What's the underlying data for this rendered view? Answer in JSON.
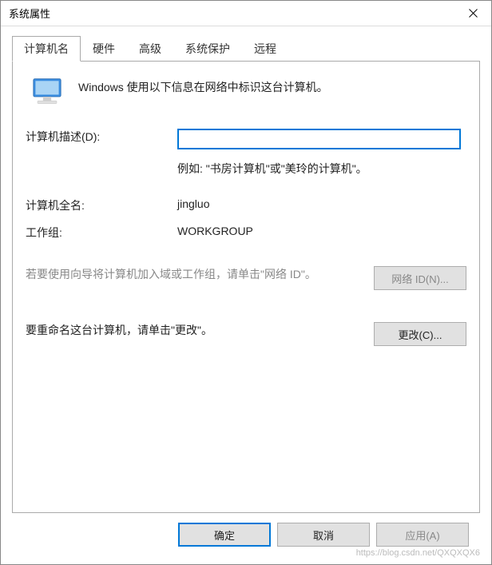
{
  "window": {
    "title": "系统属性"
  },
  "tabs": {
    "computer_name": "计算机名",
    "hardware": "硬件",
    "advanced": "高级",
    "system_protection": "系统保护",
    "remote": "远程"
  },
  "panel": {
    "intro": "Windows 使用以下信息在网络中标识这台计算机。",
    "description_label": "计算机描述(D):",
    "description_value": "",
    "description_hint": "例如: \"书房计算机\"或\"美玲的计算机\"。",
    "full_name_label": "计算机全名:",
    "full_name_value": "jingluo",
    "workgroup_label": "工作组:",
    "workgroup_value": "WORKGROUP",
    "network_id_text": "若要使用向导将计算机加入域或工作组，请单击\"网络 ID\"。",
    "network_id_button": "网络 ID(N)...",
    "rename_text": "要重命名这台计算机，请单击\"更改\"。",
    "rename_button": "更改(C)..."
  },
  "footer": {
    "ok": "确定",
    "cancel": "取消",
    "apply": "应用(A)"
  },
  "watermark": "https://blog.csdn.net/QXQXQX6"
}
